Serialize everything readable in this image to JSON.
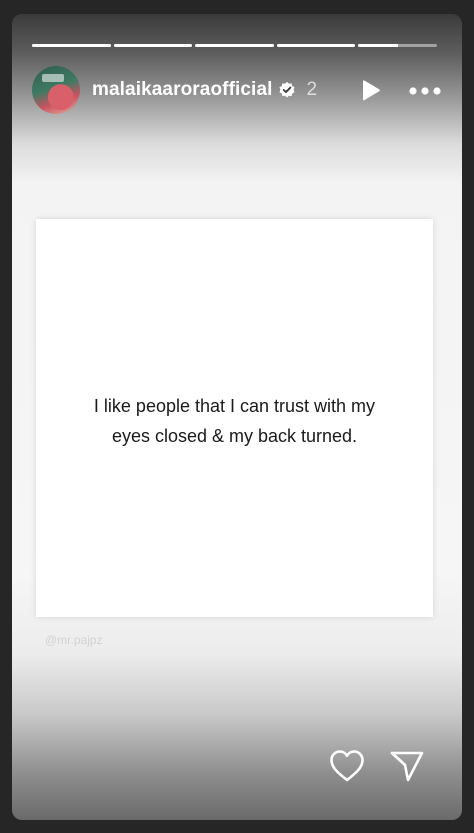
{
  "story": {
    "username": "malaikaarora",
    "username_suffix": "official",
    "timestamp": "2",
    "progress": {
      "segments": [
        1,
        1,
        1,
        1,
        0.5
      ]
    },
    "quote_line_1": "I like people that I can trust with my",
    "quote_line_2": "eyes closed & my back turned.",
    "watermark": "@mr.pajpz"
  },
  "icons": {
    "avatar": "profile-photo",
    "verified": "verified-badge-icon",
    "play": "play-icon",
    "more": "more-options-icon",
    "like": "heart-icon",
    "share": "send-icon"
  },
  "colors": {
    "frame": "#262626",
    "text_light": "#ffffff",
    "quote_text": "#1a1a1a"
  }
}
